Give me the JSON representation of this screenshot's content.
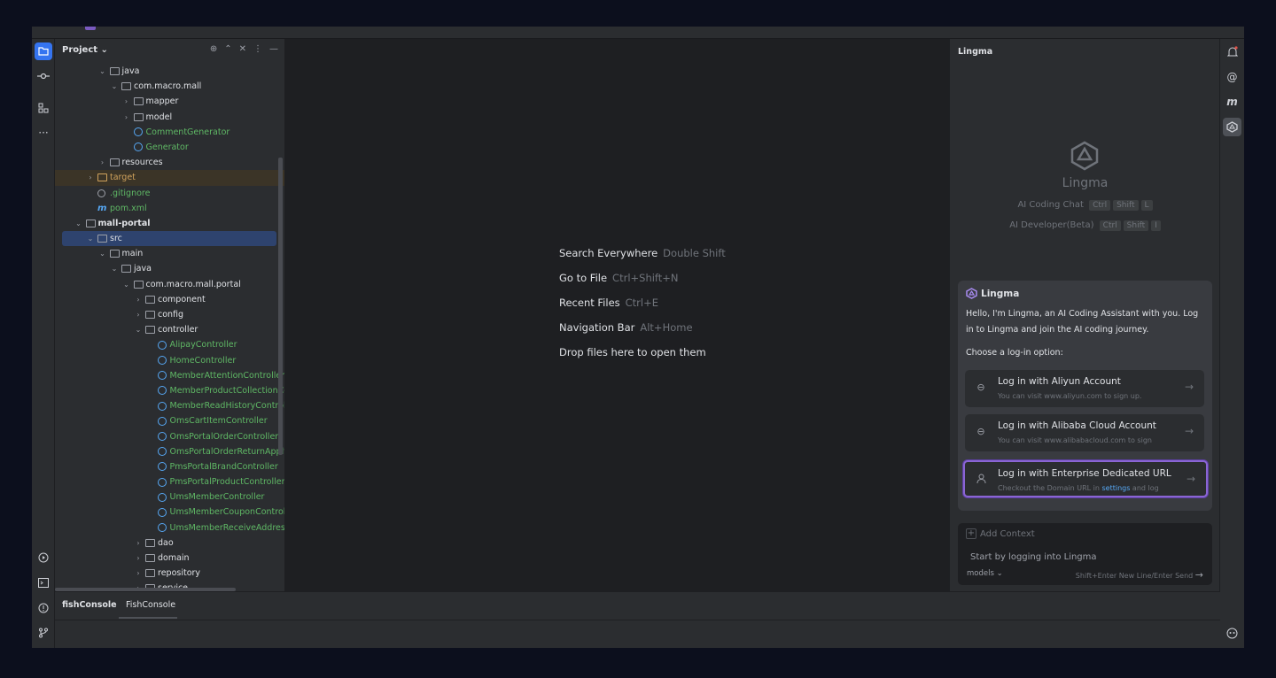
{
  "project": {
    "title": "Project",
    "tree": [
      {
        "label": "java",
        "indent": 3,
        "arrow": "v",
        "icon": "folder",
        "style": ""
      },
      {
        "label": "com.macro.mall",
        "indent": 4,
        "arrow": "v",
        "icon": "package",
        "style": ""
      },
      {
        "label": "mapper",
        "indent": 5,
        "arrow": ">",
        "icon": "package",
        "style": ""
      },
      {
        "label": "model",
        "indent": 5,
        "arrow": ">",
        "icon": "package",
        "style": ""
      },
      {
        "label": "CommentGenerator",
        "indent": 5,
        "arrow": "",
        "icon": "class",
        "style": "green"
      },
      {
        "label": "Generator",
        "indent": 5,
        "arrow": "",
        "icon": "class",
        "style": "green"
      },
      {
        "label": "resources",
        "indent": 3,
        "arrow": ">",
        "icon": "folder",
        "style": ""
      },
      {
        "label": "target",
        "indent": 2,
        "arrow": ">",
        "icon": "target",
        "style": "orange target-row"
      },
      {
        "label": ".gitignore",
        "indent": 2,
        "arrow": "",
        "icon": "ignore",
        "style": "green"
      },
      {
        "label": "pom.xml",
        "indent": 2,
        "arrow": "",
        "icon": "maven",
        "style": "green"
      },
      {
        "label": "mall-portal",
        "indent": 1,
        "arrow": "v",
        "icon": "folder",
        "style": "bold"
      },
      {
        "label": "src",
        "indent": 2,
        "arrow": "v",
        "icon": "folder",
        "style": "selected"
      },
      {
        "label": "main",
        "indent": 3,
        "arrow": "v",
        "icon": "folder",
        "style": ""
      },
      {
        "label": "java",
        "indent": 4,
        "arrow": "v",
        "icon": "folder",
        "style": ""
      },
      {
        "label": "com.macro.mall.portal",
        "indent": 5,
        "arrow": "v",
        "icon": "package",
        "style": ""
      },
      {
        "label": "component",
        "indent": 6,
        "arrow": ">",
        "icon": "package",
        "style": ""
      },
      {
        "label": "config",
        "indent": 6,
        "arrow": ">",
        "icon": "package",
        "style": ""
      },
      {
        "label": "controller",
        "indent": 6,
        "arrow": "v",
        "icon": "package",
        "style": ""
      },
      {
        "label": "AlipayController",
        "indent": 7,
        "arrow": "",
        "icon": "class",
        "style": "green"
      },
      {
        "label": "HomeController",
        "indent": 7,
        "arrow": "",
        "icon": "class",
        "style": "green"
      },
      {
        "label": "MemberAttentionController",
        "indent": 7,
        "arrow": "",
        "icon": "class",
        "style": "green"
      },
      {
        "label": "MemberProductCollectionCon",
        "indent": 7,
        "arrow": "",
        "icon": "class",
        "style": "green"
      },
      {
        "label": "MemberReadHistoryController",
        "indent": 7,
        "arrow": "",
        "icon": "class",
        "style": "green"
      },
      {
        "label": "OmsCartItemController",
        "indent": 7,
        "arrow": "",
        "icon": "class",
        "style": "green"
      },
      {
        "label": "OmsPortalOrderController",
        "indent": 7,
        "arrow": "",
        "icon": "class",
        "style": "green"
      },
      {
        "label": "OmsPortalOrderReturnApplyC",
        "indent": 7,
        "arrow": "",
        "icon": "class",
        "style": "green"
      },
      {
        "label": "PmsPortalBrandController",
        "indent": 7,
        "arrow": "",
        "icon": "class",
        "style": "green"
      },
      {
        "label": "PmsPortalProductController",
        "indent": 7,
        "arrow": "",
        "icon": "class",
        "style": "green"
      },
      {
        "label": "UmsMemberController",
        "indent": 7,
        "arrow": "",
        "icon": "class",
        "style": "green"
      },
      {
        "label": "UmsMemberCouponController",
        "indent": 7,
        "arrow": "",
        "icon": "class",
        "style": "green"
      },
      {
        "label": "UmsMemberReceiveAddressC",
        "indent": 7,
        "arrow": "",
        "icon": "class",
        "style": "green"
      },
      {
        "label": "dao",
        "indent": 6,
        "arrow": ">",
        "icon": "package",
        "style": ""
      },
      {
        "label": "domain",
        "indent": 6,
        "arrow": ">",
        "icon": "package",
        "style": ""
      },
      {
        "label": "repository",
        "indent": 6,
        "arrow": ">",
        "icon": "package",
        "style": ""
      },
      {
        "label": "service",
        "indent": 6,
        "arrow": ">",
        "icon": "package",
        "style": ""
      }
    ]
  },
  "editor": {
    "hints": [
      {
        "label": "Search Everywhere",
        "key": "Double Shift"
      },
      {
        "label": "Go to File",
        "key": "Ctrl+Shift+N"
      },
      {
        "label": "Recent Files",
        "key": "Ctrl+E"
      },
      {
        "label": "Navigation Bar",
        "key": "Alt+Home"
      },
      {
        "label": "Drop files here to open them",
        "key": ""
      }
    ]
  },
  "lingma": {
    "panel_title": "Lingma",
    "brand": "Lingma",
    "shortcut1_label": "AI Coding Chat",
    "shortcut1_keys": [
      "Ctrl",
      "Shift",
      "L"
    ],
    "shortcut2_label": "AI Developer(Beta)",
    "shortcut2_keys": [
      "Ctrl",
      "Shift",
      "I"
    ],
    "card_title": "Lingma",
    "card_body": "Hello, I'm Lingma, an AI Coding Assistant with you. Log in to Lingma and join the AI coding journey.",
    "choose": "Choose a log-in option:",
    "options": [
      {
        "title": "Log in with Aliyun Account",
        "sub": "You can visit www.aliyun.com to sign up.",
        "icon": "link-icon"
      },
      {
        "title": "Log in with Alibaba Cloud Account",
        "sub": "You can visit www.alibabacloud.com to sign",
        "icon": "link-icon"
      },
      {
        "title": "Log in with Enterprise Dedicated URL",
        "sub_before": "Checkout the Domain URL in ",
        "sub_link": "settings",
        "sub_after": " and log",
        "icon": "user-icon"
      }
    ],
    "add_context": "Add Context",
    "input_placeholder": "Start by logging into Lingma",
    "models_label": "models",
    "send_hint": "Shift+Enter New Line/Enter Send"
  },
  "bottom": {
    "tab1": "fishConsole",
    "tab2": "FishConsole"
  },
  "colors": {
    "accent": "#3574f0",
    "highlight_border": "#8a65d4",
    "green_file": "#5fb865",
    "target_folder": "#d0a25c"
  }
}
